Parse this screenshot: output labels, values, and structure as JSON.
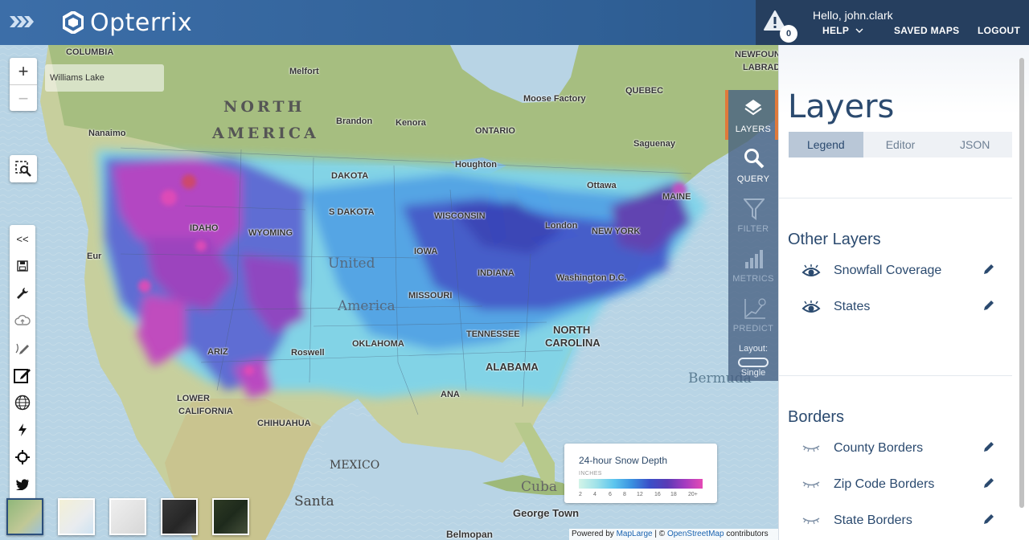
{
  "app": {
    "name": "Opterrix"
  },
  "header": {
    "greeting": "Hello, john.clark",
    "alert_count": "0",
    "help_label": "HELP",
    "saved_maps_label": "SAVED MAPS",
    "logout_label": "LOGOUT"
  },
  "map": {
    "search_value": "Williams Lake",
    "zoom_in": "+",
    "zoom_out": "−",
    "toolbar_collapse": "<<",
    "labels": {
      "columbia": "COLUMBIA",
      "melfort": "Melfort",
      "north": "NORTH",
      "america": "AMERICA",
      "brandon": "Brandon",
      "kenora": "Kenora",
      "moose_factory": "Moose Factory",
      "quebec": "QUEBEC",
      "newfoundland_1": "NEWFOUNDL",
      "newfoundland_2": "LABRAD",
      "nanaimo": "Nanaimo",
      "ontario": "ONTARIO",
      "saguenay": "Saguenay",
      "houghton": "Houghton",
      "ottawa": "Ottawa",
      "n_dakota": "DAKOTA",
      "s_dakota": "S DAKOTA",
      "wisconsin": "WISCONSIN",
      "london": "London",
      "new_york": "NEW YORK",
      "maine": "MAINE",
      "idaho": "IDAHO",
      "wyoming": "WYOMING",
      "iowa": "IOWA",
      "indiana": "INDIANA",
      "washington_dc": "Washington D.C.",
      "eureka": "Eur",
      "united": "United",
      "america_us": "America",
      "missouri": "MISSOURI",
      "arizona": "ARIZ",
      "oklahoma": "OKLAHOMA",
      "tennessee": "TENNESSEE",
      "north_carolina_1": "NORTH",
      "north_carolina_2": "CAROLINA",
      "roswell": "Roswell",
      "alabama": "ALABAMA",
      "louisiana": "ANA",
      "bermuda": "Bermuda",
      "lower": "LOWER",
      "california": "CALIFORNIA",
      "chihuahua": "CHIHUAHUA",
      "mexico": "MEXICO",
      "santa": "Santa",
      "george_town": "George Town",
      "cuba": "Cuba",
      "belmopan": "Belmopan"
    },
    "basemaps": [
      "Satellite",
      "Light",
      "Gray",
      "Dark",
      "Imagery"
    ],
    "basemap_active": "Satellite"
  },
  "legend": {
    "title": "24-hour Snow Depth",
    "unit": "INCHES",
    "ticks": [
      "2",
      "4",
      "6",
      "8",
      "12",
      "16",
      "18",
      "20+"
    ],
    "colors": [
      "#d3f4e8",
      "#9fe2e9",
      "#5cc5ee",
      "#3a90e0",
      "#3a4fc8",
      "#5a3bb5",
      "#a43cc0",
      "#e54ab5"
    ]
  },
  "attribution": {
    "prefix": "Powered by ",
    "maplarge": "MapLarge",
    "sep": " | © ",
    "osm": "OpenStreetMap",
    "suffix": " contributors"
  },
  "vtools": {
    "layers": "LAYERS",
    "query": "QUERY",
    "filter": "FILTER",
    "metrics": "METRICS",
    "predict": "PREDICT",
    "layout_label": "Layout:",
    "layout_value": "Single"
  },
  "panel": {
    "title": "Layers",
    "tabs": [
      "Legend",
      "Editor",
      "JSON"
    ],
    "active_tab": "Legend",
    "other_layers_title": "Other Layers",
    "other_layers": [
      {
        "name": "Snowfall Coverage",
        "visible": true
      },
      {
        "name": "States",
        "visible": true
      }
    ],
    "borders_title": "Borders",
    "borders": [
      {
        "name": "County Borders",
        "visible": false
      },
      {
        "name": "Zip Code Borders",
        "visible": false
      },
      {
        "name": "State Borders",
        "visible": false
      }
    ]
  },
  "colors": {
    "header": "#2f5f95",
    "user_box": "#263f5f",
    "panel_text": "#2b4a6f",
    "accent": "#e07a3b"
  }
}
